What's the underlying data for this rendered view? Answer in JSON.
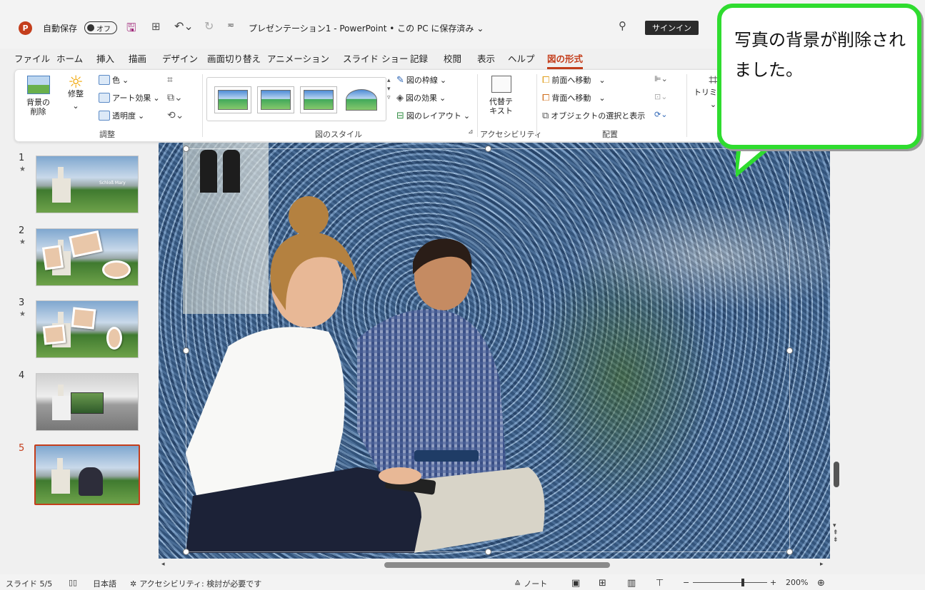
{
  "titlebar": {
    "app_icon_letter": "P",
    "autosave_label": "自動保存",
    "autosave_state": "オフ",
    "doc_title": "プレゼンテーション1  -  PowerPoint • この PC に保存済み",
    "signin_label": "サインイン"
  },
  "menu": {
    "items": [
      "ファイル",
      "ホーム",
      "挿入",
      "描画",
      "デザイン",
      "画面切り替え",
      "アニメーション",
      "スライド ショー",
      "記録",
      "校閲",
      "表示",
      "ヘルプ",
      "図の形式"
    ],
    "active": "図の形式"
  },
  "ribbon": {
    "remove_bg": "背景の\n削除",
    "corrections": "修整",
    "color": "色",
    "artistic": "アート効果",
    "transparency": "透明度",
    "group_adjust": "調整",
    "border": "図の枠線",
    "effects": "図の効果",
    "layout": "図のレイアウト",
    "group_styles": "図のスタイル",
    "alt_text": "代替テ\nキスト",
    "group_access": "アクセシビリティ",
    "bring_forward": "前面へ移動",
    "send_backward": "背面へ移動",
    "selection_pane": "オブジェクトの選択と表示",
    "group_arrange": "配置",
    "crop": "トリミング"
  },
  "slides": [
    {
      "num": "1",
      "star": "★"
    },
    {
      "num": "2",
      "star": "★"
    },
    {
      "num": "3",
      "star": "★"
    },
    {
      "num": "4",
      "star": ""
    },
    {
      "num": "5",
      "star": ""
    }
  ],
  "slide1_caption": "Schloß Mary",
  "status": {
    "slide": "スライド 5/5",
    "language": "日本語",
    "accessibility": "アクセシビリティ: 検討が必要です",
    "notes": "ノート",
    "zoom": "200%",
    "zoom_minus": "−",
    "zoom_plus": "+"
  },
  "callout": {
    "text": "写真の背景が削除されました。",
    "border_color": "#2fdc2f"
  },
  "colors": {
    "accent": "#c43e1c"
  }
}
